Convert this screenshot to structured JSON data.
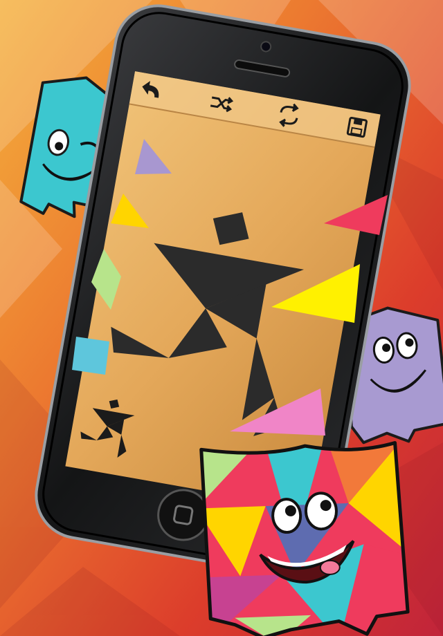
{
  "app": {
    "genre": "tangram puzzle"
  },
  "colors": {
    "background_top": "#f3a23a",
    "background_mid": "#e4542c",
    "background_bottom": "#c82a33",
    "phone_body": "#1e1f21",
    "screen_paper": "#e2a955",
    "silhouette": "#2b2b2b",
    "piece_purple": "#a897d0",
    "piece_yellow": "#ffd500",
    "piece_green": "#b7e48b",
    "piece_blue": "#5ec6dc",
    "piece_red": "#ef3b5d",
    "piece_bright_yellow": "#fff100",
    "piece_pink": "#f085c7",
    "mascot_teal": "#3cc7cf",
    "mascot_lavender": "#a89ad1"
  },
  "toolbar": {
    "undo_icon": "undo-arrow-icon",
    "shuffle_icon": "shuffle-icon",
    "rotate_icon": "rotate-icon",
    "save_icon": "floppy-disk-icon"
  },
  "board": {
    "target_figure": "running-man",
    "pieces": [
      {
        "id": "purple-triangle",
        "color": "#a897d0"
      },
      {
        "id": "yellow-triangle",
        "color": "#ffd500"
      },
      {
        "id": "green-parallelogram",
        "color": "#b7e48b"
      },
      {
        "id": "blue-square",
        "color": "#5ec6dc"
      },
      {
        "id": "red-triangle",
        "color": "#ef3b5d"
      },
      {
        "id": "bright-yellow-triangle",
        "color": "#fff100"
      },
      {
        "id": "pink-triangle",
        "color": "#f085c7"
      }
    ]
  }
}
